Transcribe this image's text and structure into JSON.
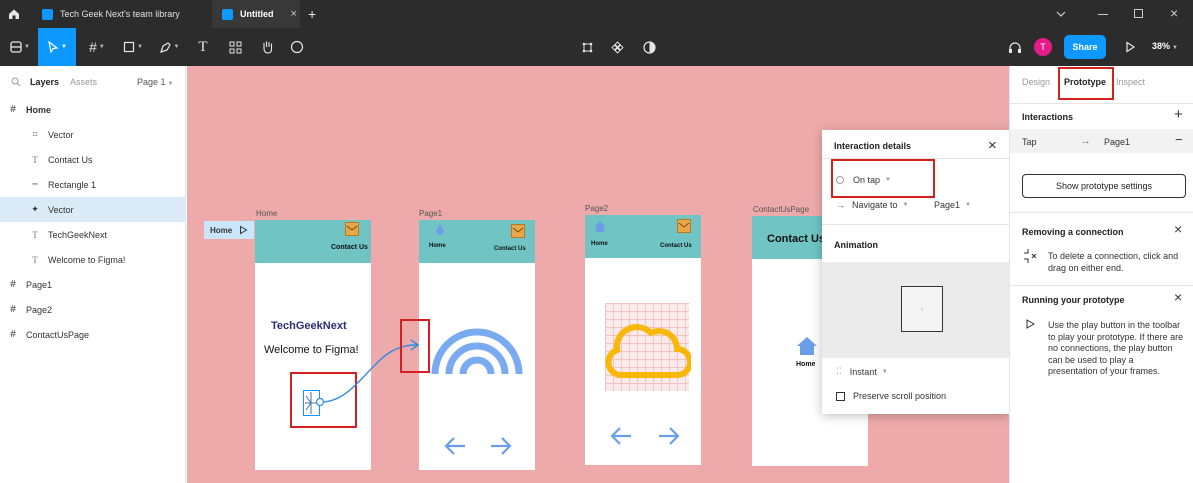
{
  "tabs": [
    {
      "label": "Tech Geek Next's team library"
    },
    {
      "label": "Untitled"
    }
  ],
  "window": {
    "zoom": "38%"
  },
  "toolbar": {
    "share_label": "Share",
    "avatar_initial": "T"
  },
  "left_panel": {
    "tab_layers": "Layers",
    "tab_assets": "Assets",
    "page_select": "Page 1",
    "layers": [
      {
        "label": "Home"
      },
      {
        "label": "Vector"
      },
      {
        "label": "Contact Us"
      },
      {
        "label": "Rectangle 1"
      },
      {
        "label": "Vector"
      },
      {
        "label": "TechGeekNext"
      },
      {
        "label": "Welcome to Figma!"
      },
      {
        "label": "Page1"
      },
      {
        "label": "Page2"
      },
      {
        "label": "ContactUsPage"
      }
    ]
  },
  "canvas": {
    "flow_start_label": "Home",
    "frames": [
      {
        "label": "Home",
        "contact": "Contact Us",
        "title": "TechGeekNext",
        "welcome": "Welcome to Figma!"
      },
      {
        "label": "Page1",
        "home": "Home",
        "contact": "Contact Us"
      },
      {
        "label": "Page2",
        "home": "Home",
        "contact": "Contact Us"
      },
      {
        "label": "ContactUsPage",
        "header": "Contact Us",
        "home": "Home"
      }
    ]
  },
  "interaction_popup": {
    "title": "Interaction details",
    "trigger": "On tap",
    "action": "Navigate to",
    "destination": "Page1",
    "animation_heading": "Animation",
    "animation_type": "Instant",
    "preserve_scroll": "Preserve scroll position"
  },
  "right_panel": {
    "tabs": [
      "Design",
      "Prototype",
      "Inspect"
    ],
    "interactions_heading": "Interactions",
    "interaction": {
      "trigger": "Tap",
      "target": "Page1"
    },
    "show_settings": "Show prototype settings",
    "removing_heading": "Removing a connection",
    "removing_text": "To delete a connection, click and drag on either end.",
    "running_heading": "Running your prototype",
    "running_text": "Use the play button in the toolbar to play your prototype. If there are no connections, the play button can be used to play a presentation of your frames."
  },
  "colors": {
    "canvas_bg": "#eeaaaa",
    "frame_header": "#70c4c4",
    "accent_blue": "#0d99ff",
    "highlight_red": "#d4201f",
    "avatar_pink": "#e31c8a",
    "cloud_yellow": "#f9b707",
    "icon_blue": "#6a9ee8"
  }
}
